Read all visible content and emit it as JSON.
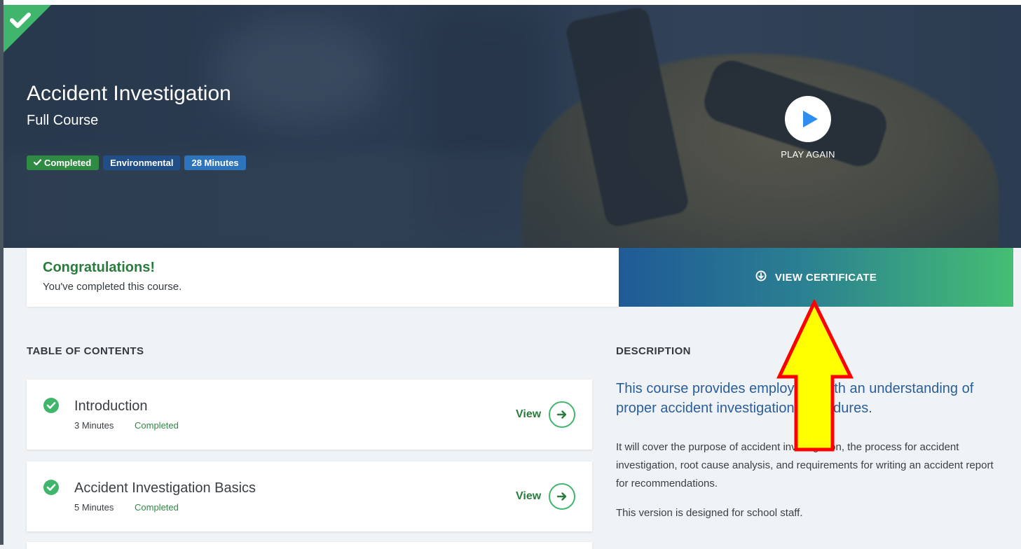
{
  "hero": {
    "title": "Accident Investigation",
    "subtitle": "Full Course",
    "badges": {
      "completed": "Completed",
      "category": "Environmental",
      "duration": "28 Minutes"
    },
    "play_label": "PLAY AGAIN",
    "corner_icon": "check-icon"
  },
  "congrats": {
    "heading": "Congratulations!",
    "message": "You've completed this course."
  },
  "certificate": {
    "label": "VIEW CERTIFICATE",
    "icon": "download-circle-icon"
  },
  "toc": {
    "heading": "TABLE OF CONTENTS",
    "items": [
      {
        "title": "Introduction",
        "minutes": "3 Minutes",
        "status": "Completed",
        "action": "View"
      },
      {
        "title": "Accident Investigation Basics",
        "minutes": "5 Minutes",
        "status": "Completed",
        "action": "View"
      }
    ]
  },
  "description": {
    "heading": "DESCRIPTION",
    "lead": "This course provides employees with an understanding of proper accident investigation procedures.",
    "para1": "It will cover the purpose of accident investigation, the process for accident investigation, root cause analysis, and requirements for writing an accident report for recommendations.",
    "para2": "This version is designed for school staff."
  },
  "colors": {
    "accent_green": "#3fb66b",
    "dark_green": "#2a7c3d",
    "blue": "#2a5d9a",
    "annotation_fill": "#ffff00",
    "annotation_stroke": "#ff0000"
  }
}
